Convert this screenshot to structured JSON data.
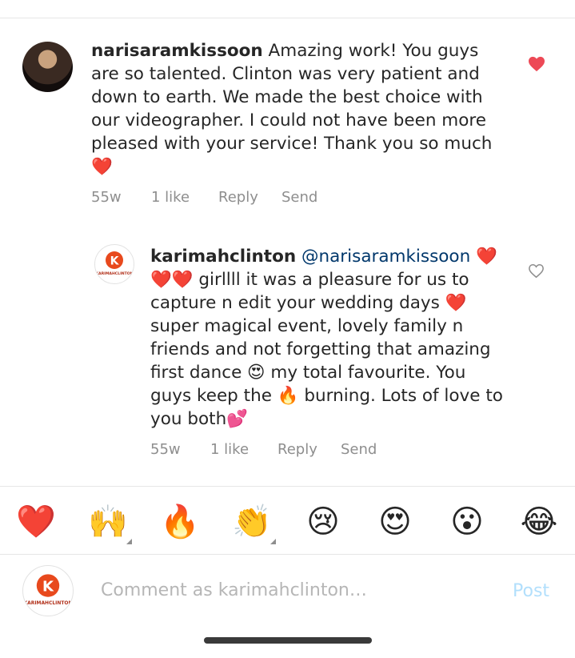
{
  "comment1": {
    "username": "narisaramkissoon",
    "text": " Amazing work!  You guys are so talented. Clinton was very patient and down to earth. We made the best choice with our videographer. I could not have been more pleased with your service! Thank you so much ❤️",
    "age": "55w",
    "likes": "1 like",
    "reply": "Reply",
    "send": "Send"
  },
  "reply1": {
    "username": "karimahclinton",
    "mention": "@narisaramkissoon",
    "text": " ❤️❤️❤️ girllll it was a pleasure for us to capture n edit your wedding days ❤️ super magical event, lovely family n friends and not forgetting that amazing first dance 😍 my total favourite. You guys keep the 🔥 burning. Lots of love to you both💕",
    "age": "55w",
    "likes": "1 like",
    "reply": "Reply",
    "send": "Send",
    "logo_text": "KARIMAHCLINTON"
  },
  "emoji_bar": [
    "❤️",
    "🙌",
    "🔥",
    "👏",
    "😢",
    "😍",
    "😮",
    "😂"
  ],
  "composer": {
    "placeholder": "Comment as karimahclinton…",
    "post": "Post",
    "logo_text": "KARIMAHCLINTON"
  },
  "colors": {
    "liked": "#ed4956",
    "link": "#00376b",
    "post_disabled": "#b2dffc"
  }
}
